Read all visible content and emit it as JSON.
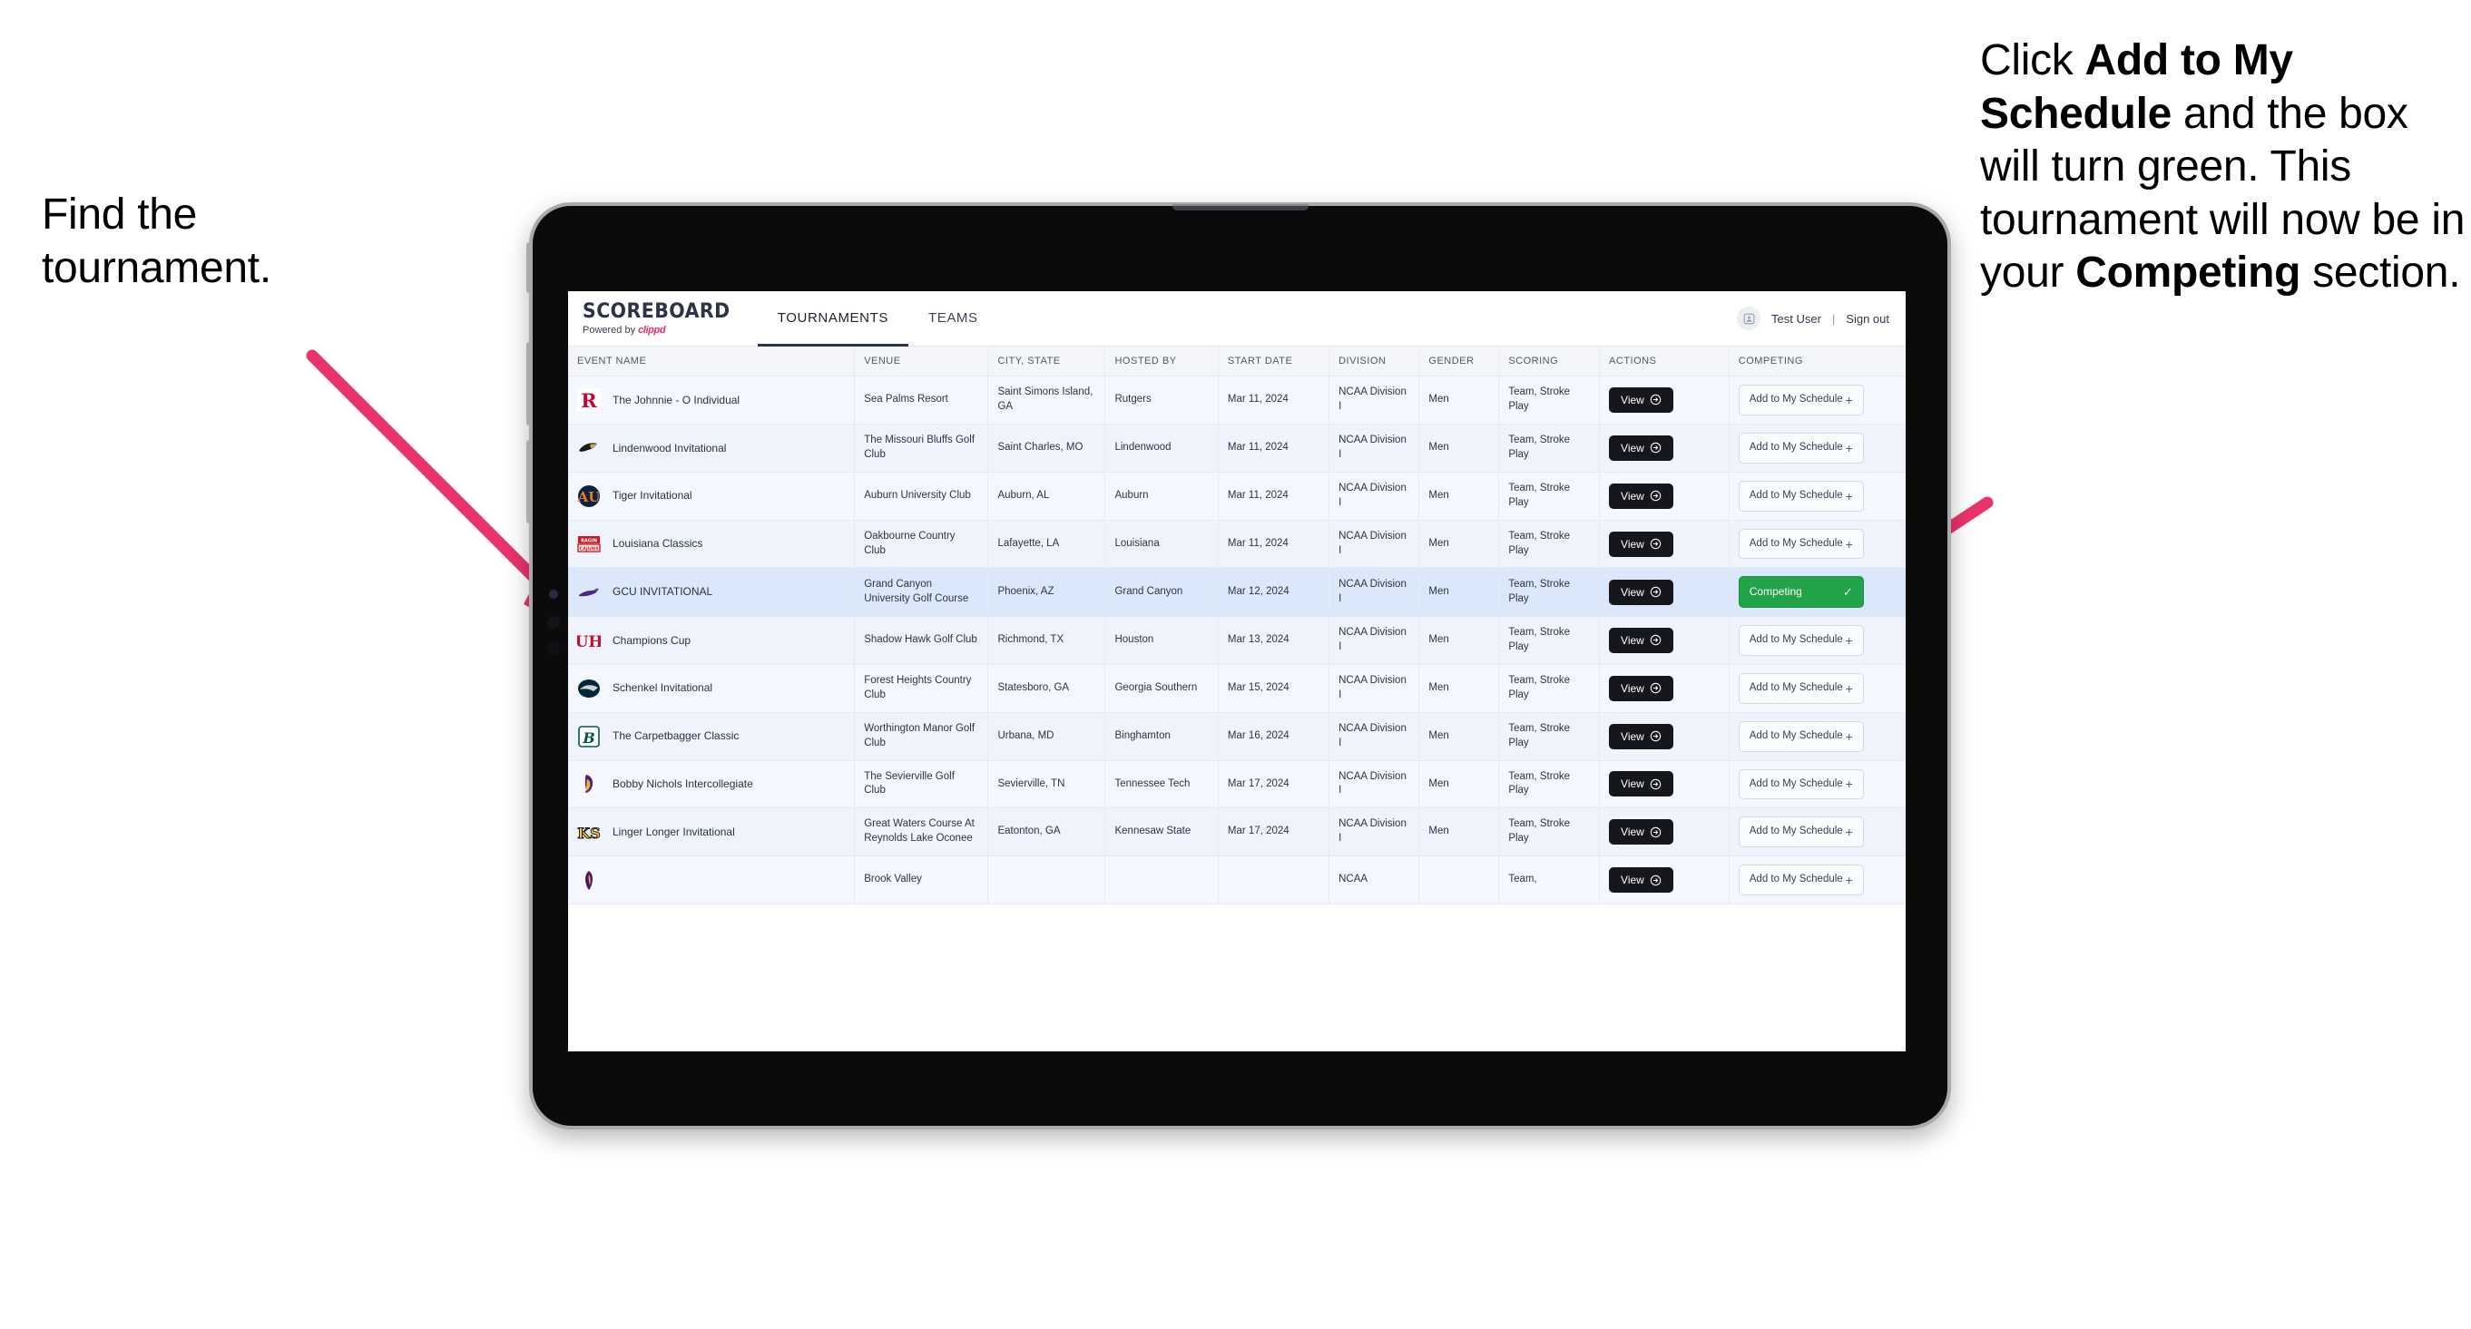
{
  "annotations": {
    "left": "Find the tournament.",
    "right_parts": [
      {
        "text": "Click ",
        "bold": false
      },
      {
        "text": "Add to My Schedule",
        "bold": true
      },
      {
        "text": " and the box will turn green. This tournament will now be in your ",
        "bold": false
      },
      {
        "text": "Competing",
        "bold": true
      },
      {
        "text": " section.",
        "bold": false
      }
    ],
    "arrow_color": "#e9346b"
  },
  "app": {
    "brand": {
      "title": "SCOREBOARD",
      "powered_prefix": "Powered by ",
      "powered_brand": "clippd"
    },
    "nav": [
      {
        "label": "TOURNAMENTS",
        "active": true
      },
      {
        "label": "TEAMS",
        "active": false
      }
    ],
    "user": {
      "name": "Test User",
      "separator": "|",
      "sign_out": "Sign out",
      "avatar_icon": "user-avatar-icon"
    },
    "columns": [
      "EVENT NAME",
      "VENUE",
      "CITY, STATE",
      "HOSTED BY",
      "START DATE",
      "DIVISION",
      "GENDER",
      "SCORING",
      "ACTIONS",
      "COMPETING"
    ],
    "buttons": {
      "view_label": "View",
      "view_icon": "arrow-right-circle-icon",
      "add_label": "Add to My Schedule",
      "add_icon": "plus-icon",
      "competing_label": "Competing",
      "competing_icon": "check-icon"
    },
    "colors": {
      "competing_green": "#22a34a",
      "accent_pink": "#ef2b63",
      "view_black": "#16171c"
    },
    "rows": [
      {
        "logo": "rutgers-r-logo",
        "event": "The Johnnie - O Individual",
        "venue": "Sea Palms Resort",
        "city": "Saint Simons Island, GA",
        "host": "Rutgers",
        "date": "Mar 11, 2024",
        "division": "NCAA Division I",
        "gender": "Men",
        "scoring": "Team, Stroke Play",
        "competing": false
      },
      {
        "logo": "lindenwood-lion-logo",
        "event": "Lindenwood Invitational",
        "venue": "The Missouri Bluffs Golf Club",
        "city": "Saint Charles, MO",
        "host": "Lindenwood",
        "date": "Mar 11, 2024",
        "division": "NCAA Division I",
        "gender": "Men",
        "scoring": "Team, Stroke Play",
        "competing": false
      },
      {
        "logo": "auburn-au-logo",
        "event": "Tiger Invitational",
        "venue": "Auburn University Club",
        "city": "Auburn, AL",
        "host": "Auburn",
        "date": "Mar 11, 2024",
        "division": "NCAA Division I",
        "gender": "Men",
        "scoring": "Team, Stroke Play",
        "competing": false
      },
      {
        "logo": "louisiana-ragin-cajuns-logo",
        "event": "Louisiana Classics",
        "venue": "Oakbourne Country Club",
        "city": "Lafayette, LA",
        "host": "Louisiana",
        "date": "Mar 11, 2024",
        "division": "NCAA Division I",
        "gender": "Men",
        "scoring": "Team, Stroke Play",
        "competing": false
      },
      {
        "logo": "gcu-lope-logo",
        "event": "GCU INVITATIONAL",
        "venue": "Grand Canyon University Golf Course",
        "city": "Phoenix, AZ",
        "host": "Grand Canyon",
        "date": "Mar 12, 2024",
        "division": "NCAA Division I",
        "gender": "Men",
        "scoring": "Team, Stroke Play",
        "competing": true
      },
      {
        "logo": "houston-uh-logo",
        "event": "Champions Cup",
        "venue": "Shadow Hawk Golf Club",
        "city": "Richmond, TX",
        "host": "Houston",
        "date": "Mar 13, 2024",
        "division": "NCAA Division I",
        "gender": "Men",
        "scoring": "Team, Stroke Play",
        "competing": false
      },
      {
        "logo": "georgia-southern-eagles-logo",
        "event": "Schenkel Invitational",
        "venue": "Forest Heights Country Club",
        "city": "Statesboro, GA",
        "host": "Georgia Southern",
        "date": "Mar 15, 2024",
        "division": "NCAA Division I",
        "gender": "Men",
        "scoring": "Team, Stroke Play",
        "competing": false
      },
      {
        "logo": "binghamton-b-logo",
        "event": "The Carpetbagger Classic",
        "venue": "Worthington Manor Golf Club",
        "city": "Urbana, MD",
        "host": "Binghamton",
        "date": "Mar 16, 2024",
        "division": "NCAA Division I",
        "gender": "Men",
        "scoring": "Team, Stroke Play",
        "competing": false
      },
      {
        "logo": "tennessee-tech-eagle-logo",
        "event": "Bobby Nichols Intercollegiate",
        "venue": "The Sevierville Golf Club",
        "city": "Sevierville, TN",
        "host": "Tennessee Tech",
        "date": "Mar 17, 2024",
        "division": "NCAA Division I",
        "gender": "Men",
        "scoring": "Team, Stroke Play",
        "competing": false
      },
      {
        "logo": "kennesaw-state-ks-logo",
        "event": "Linger Longer Invitational",
        "venue": "Great Waters Course At Reynolds Lake Oconee",
        "city": "Eatonton, GA",
        "host": "Kennesaw State",
        "date": "Mar 17, 2024",
        "division": "NCAA Division I",
        "gender": "Men",
        "scoring": "Team, Stroke Play",
        "competing": false
      },
      {
        "logo": "east-carolina-pirate-logo",
        "event": "",
        "venue": "Brook Valley",
        "city": "",
        "host": "",
        "date": "",
        "division": "NCAA",
        "gender": "",
        "scoring": "Team,",
        "competing": false
      }
    ]
  }
}
